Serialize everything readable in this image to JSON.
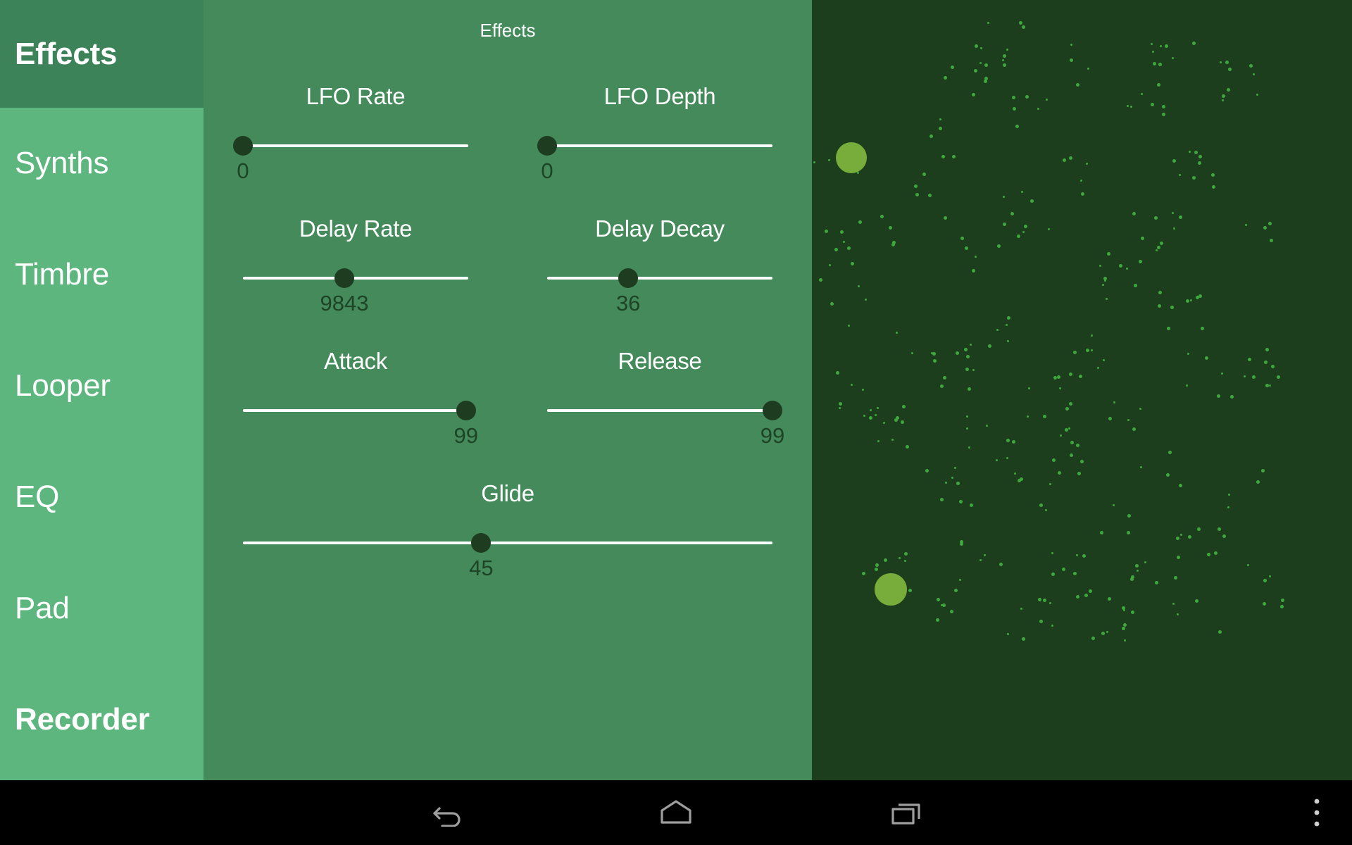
{
  "app": {
    "screen_title": "Effects",
    "theme": {
      "sidebar_header_bg": "#3d8359",
      "sidebar_bg": "#5cb67e",
      "content_bg": "#448a5b",
      "visualizer_bg": "#1d3e1d",
      "track_color": "#ffffff",
      "thumb_color": "#1e3d20",
      "value_color": "#1e4426",
      "blob_color": "#78ac3b",
      "dot_color": "#3ea83e",
      "navbar_bg": "#000000",
      "nav_icon_color": "#9e9e9e"
    }
  },
  "sidebar": {
    "header": {
      "label": "Effects"
    },
    "items": [
      {
        "label": "Synths"
      },
      {
        "label": "Timbre"
      },
      {
        "label": "Looper"
      },
      {
        "label": "EQ"
      },
      {
        "label": "Pad"
      },
      {
        "label": "Recorder"
      }
    ]
  },
  "content": {
    "title": "Effects",
    "sliders": [
      {
        "label": "LFO Rate",
        "value": "0",
        "percent": 0
      },
      {
        "label": "LFO Depth",
        "value": "0",
        "percent": 0
      },
      {
        "label": "Delay Rate",
        "value": "9843",
        "percent": 45
      },
      {
        "label": "Delay Decay",
        "value": "36",
        "percent": 36
      },
      {
        "label": "Attack",
        "value": "99",
        "percent": 99
      },
      {
        "label": "Release",
        "value": "99",
        "percent": 100
      },
      {
        "label": "Glide",
        "value": "45",
        "percent": 45
      }
    ]
  },
  "navbar": {
    "buttons": [
      {
        "name": "back",
        "label": "Back"
      },
      {
        "name": "home",
        "label": "Home"
      },
      {
        "name": "recent",
        "label": "Recent apps"
      },
      {
        "name": "more",
        "label": "More options"
      }
    ]
  }
}
